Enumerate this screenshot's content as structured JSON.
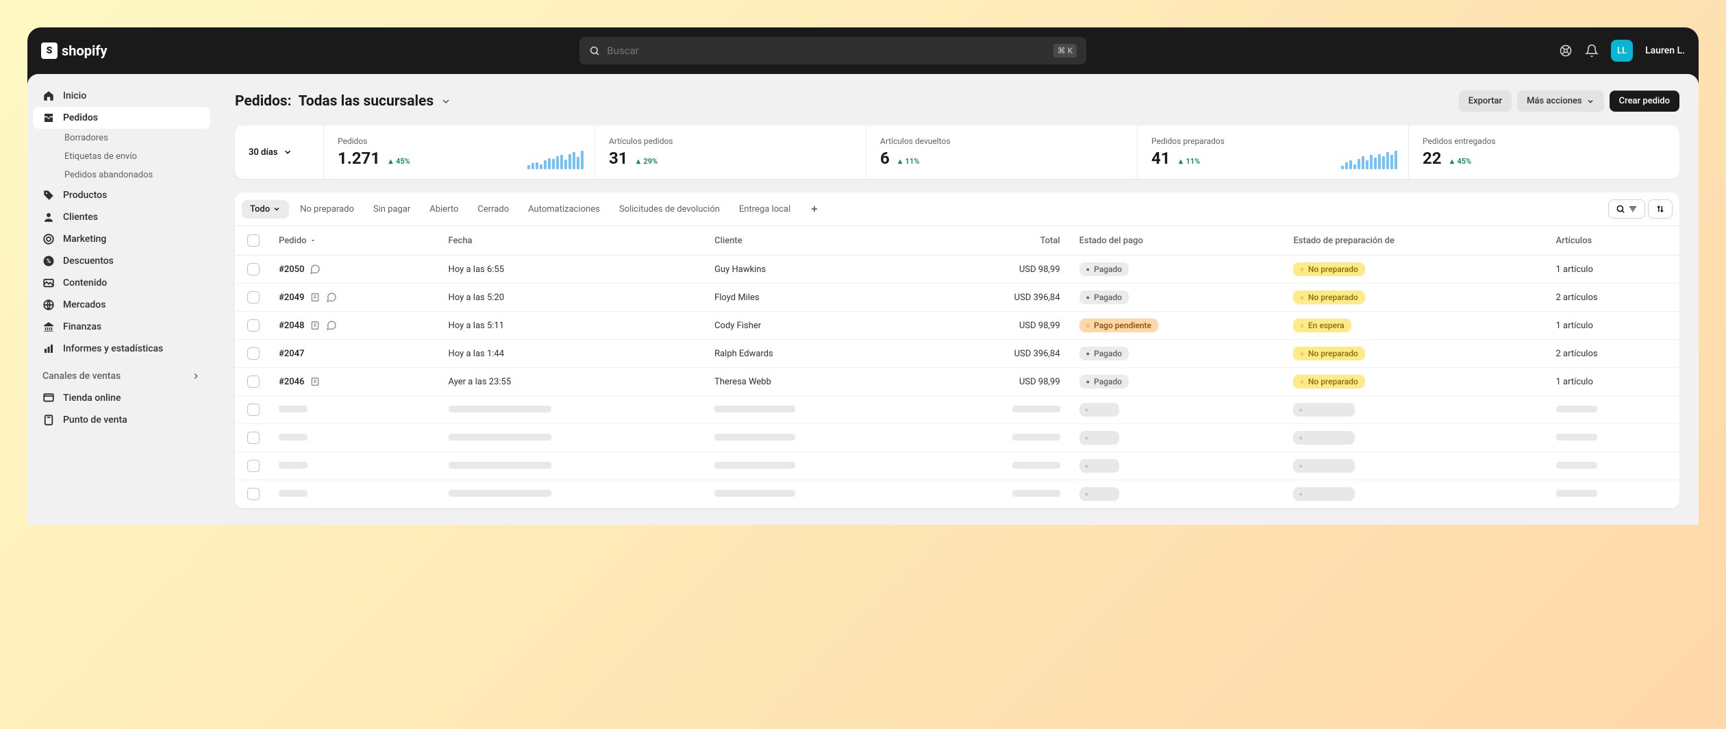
{
  "brand": "shopify",
  "search": {
    "placeholder": "Buscar",
    "kbd": "⌘ K"
  },
  "user": {
    "initials": "LL",
    "name": "Lauren L."
  },
  "sidebar": {
    "items": [
      {
        "label": "Inicio"
      },
      {
        "label": "Pedidos"
      },
      {
        "label": "Productos"
      },
      {
        "label": "Clientes"
      },
      {
        "label": "Marketing"
      },
      {
        "label": "Descuentos"
      },
      {
        "label": "Contenido"
      },
      {
        "label": "Mercados"
      },
      {
        "label": "Finanzas"
      },
      {
        "label": "Informes y estadísticas"
      }
    ],
    "orderSubs": [
      {
        "label": "Borradores"
      },
      {
        "label": "Etiquetas de envío"
      },
      {
        "label": "Pedidos abandonados"
      }
    ],
    "channelsHeader": "Canales de ventas",
    "channels": [
      {
        "label": "Tienda online"
      },
      {
        "label": "Punto de venta"
      }
    ]
  },
  "page": {
    "titlePrefix": "Pedidos:",
    "titleLocation": "Todas las sucursales",
    "exportBtn": "Exportar",
    "moreActionsBtn": "Más acciones",
    "createBtn": "Crear pedido"
  },
  "period": "30 días",
  "stats": [
    {
      "label": "Pedidos",
      "value": "1.271",
      "delta": "45%"
    },
    {
      "label": "Artículos pedidos",
      "value": "31",
      "delta": "29%"
    },
    {
      "label": "Artículos devueltos",
      "value": "6",
      "delta": "11%"
    },
    {
      "label": "Pedidos preparados",
      "value": "41",
      "delta": "11%"
    },
    {
      "label": "Pedidos entregados",
      "value": "22",
      "delta": "45%"
    }
  ],
  "tabs": [
    "Todo",
    "No preparado",
    "Sin pagar",
    "Abierto",
    "Cerrado",
    "Automatizaciones",
    "Solicitudes de devolución",
    "Entrega local"
  ],
  "columns": {
    "order": "Pedido",
    "date": "Fecha",
    "customer": "Cliente",
    "total": "Total",
    "payment": "Estado del pago",
    "fulfillment": "Estado de preparación de",
    "items": "Artículos"
  },
  "badges": {
    "paid": "Pagado",
    "paymentPending": "Pago pendiente",
    "unfulfilled": "No preparado",
    "onHold": "En espera"
  },
  "orders": [
    {
      "id": "#2050",
      "date": "Hoy a las 6:55",
      "customer": "Guy Hawkins",
      "total": "USD 98,99",
      "payment": "paid",
      "fulfillment": "unfulfilled",
      "items": "1 artículo",
      "icons": [
        "chat"
      ]
    },
    {
      "id": "#2049",
      "date": "Hoy a las 5:20",
      "customer": "Floyd Miles",
      "total": "USD 396,84",
      "payment": "paid",
      "fulfillment": "unfulfilled",
      "items": "2 artículos",
      "icons": [
        "note",
        "chat"
      ]
    },
    {
      "id": "#2048",
      "date": "Hoy a las 5:11",
      "customer": "Cody Fisher",
      "total": "USD 98,99",
      "payment": "pending",
      "fulfillment": "hold",
      "items": "1 artículo",
      "icons": [
        "note",
        "chat"
      ]
    },
    {
      "id": "#2047",
      "date": "Hoy a las 1:44",
      "customer": "Ralph Edwards",
      "total": "USD 396,84",
      "payment": "paid",
      "fulfillment": "unfulfilled",
      "items": "2 artículos",
      "icons": []
    },
    {
      "id": "#2046",
      "date": "Ayer a las 23:55",
      "customer": "Theresa Webb",
      "total": "USD 98,99",
      "payment": "paid",
      "fulfillment": "unfulfilled",
      "items": "1 artículo",
      "icons": [
        "note"
      ]
    }
  ],
  "chart_data": [
    {
      "type": "bar",
      "title": "Pedidos",
      "values": [
        8,
        10,
        12,
        6,
        14,
        18,
        16,
        20,
        22,
        15,
        24,
        26,
        18,
        28
      ],
      "ylim": [
        0,
        30
      ]
    },
    {
      "type": "bar",
      "title": "Pedidos preparados",
      "values": [
        6,
        10,
        14,
        8,
        16,
        20,
        14,
        22,
        18,
        24,
        20,
        26,
        22,
        28
      ],
      "ylim": [
        0,
        30
      ]
    }
  ]
}
